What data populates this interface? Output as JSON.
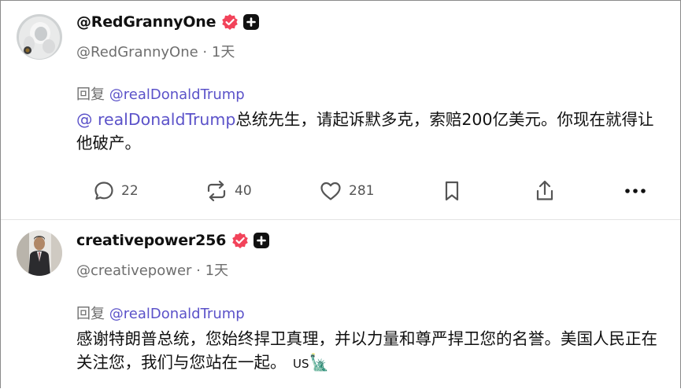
{
  "posts": [
    {
      "display_name": "@RedGrannyOne",
      "handle": "@RedGrannyOne",
      "separator": " · ",
      "time": "1天",
      "reply_prefix": "回复 ",
      "reply_to": "@realDonaldTrump",
      "body_mention": "@ realDonaldTrump",
      "body_text": "总统先生，请起诉默多克，索赔200亿美元。你现在就得让他破产。",
      "actions": {
        "comments": "22",
        "reposts": "40",
        "likes": "281"
      }
    },
    {
      "display_name": "creativepower256",
      "handle": "@creativepower",
      "separator": " · ",
      "time": "1天",
      "reply_prefix": "回复 ",
      "reply_to": "@realDonaldTrump",
      "body_text": "感谢特朗普总统，您始终捍卫真理，并以力量和尊严捍卫您的名誉。美国人民正在关注您，我们与您站在一起。",
      "body_flag_text": "US",
      "body_emoji": "🗽"
    }
  ],
  "icons": {
    "verified": "verified-badge-icon",
    "plus": "plus-badge-icon",
    "comment": "comment-icon",
    "repost": "repost-icon",
    "like": "heart-icon",
    "bookmark": "bookmark-icon",
    "share": "share-icon",
    "more": "more-dots-icon"
  },
  "colors": {
    "verified": "#f2435a",
    "mention": "#5b52c9",
    "muted": "#6e6e6e"
  }
}
